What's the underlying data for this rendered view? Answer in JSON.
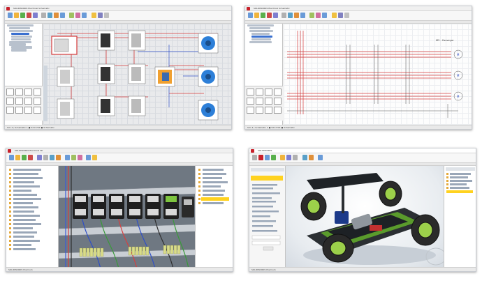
{
  "tiles": [
    {
      "id": 1,
      "title": "SOLIDWORKS Electrical Schematic",
      "status": "Sch  3 / Schematic  1  ●  5217701 ●  Schematic"
    },
    {
      "id": 2,
      "title": "SOLIDWORKS Electrical Schematic",
      "status": "Sch  3 / Schematic  1  ●  5217701 ●  Schematic",
      "label": "M3 - Conveyor"
    },
    {
      "id": 3,
      "title": "SOLIDWORKS Electrical 3D",
      "status": "SOLIDWORKS Premium"
    },
    {
      "id": 4,
      "title": "SOLIDWORKS",
      "status": "SOLIDWORKS Premium"
    }
  ],
  "colors": {
    "brand": "#c8202a",
    "wire_red": "#d53a3a",
    "wire_blue": "#2f4fc7",
    "motor_blue": "#2d7fd8",
    "car_green": "#7ec540",
    "highlight": "#ffd21f"
  },
  "icons": [
    "solidworks-logo-icon",
    "motor-icon",
    "contactor-icon",
    "terminal-icon",
    "car-model-icon"
  ]
}
